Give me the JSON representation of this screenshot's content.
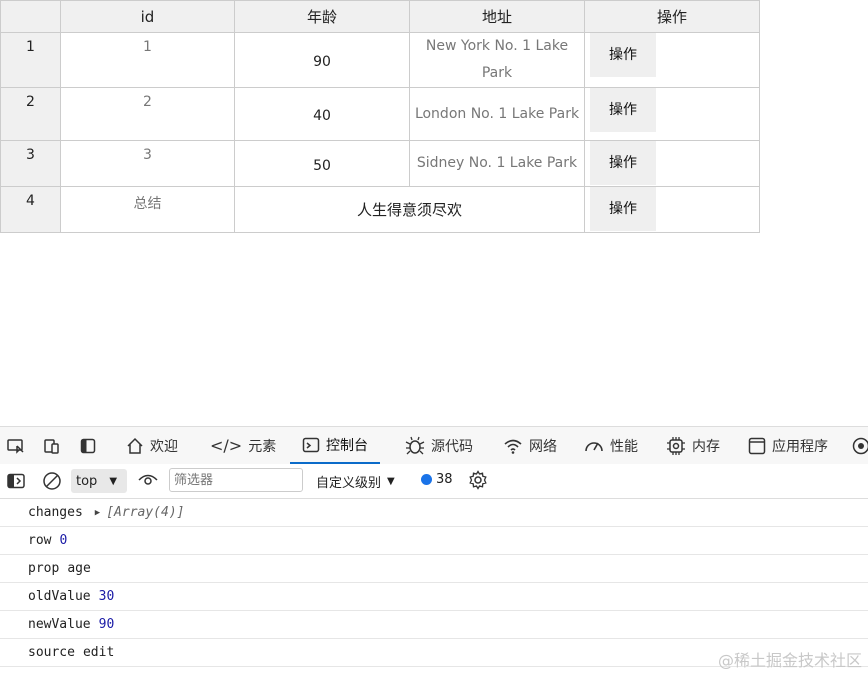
{
  "table": {
    "headers": [
      "",
      "id",
      "年龄",
      "地址",
      "操作"
    ],
    "rows": [
      {
        "rownum": "1",
        "id": "1",
        "age": "90",
        "address": "New York No. 1 Lake Park",
        "op": "操作"
      },
      {
        "rownum": "2",
        "id": "2",
        "age": "40",
        "address": "London No. 1 Lake Park",
        "op": "操作"
      },
      {
        "rownum": "3",
        "id": "3",
        "age": "50",
        "address": "Sidney No. 1 Lake Park",
        "op": "操作"
      }
    ],
    "summary": {
      "rownum": "4",
      "id": "总结",
      "merged": "人生得意须尽欢",
      "op": "操作"
    }
  },
  "devtools": {
    "tabs": {
      "welcome": "欢迎",
      "elements": "元素",
      "console": "控制台",
      "sources": "源代码",
      "network": "网络",
      "performance": "性能",
      "memory": "内存",
      "application": "应用程序"
    },
    "toolbar": {
      "context": "top",
      "filter_placeholder": "筛选器",
      "level": "自定义级别",
      "message_count": "38"
    },
    "console_lines": [
      {
        "key": "changes",
        "value": "[Array(4)]"
      },
      {
        "key": "row",
        "value": "0"
      },
      {
        "key": "prop",
        "value": "age"
      },
      {
        "key": "oldValue",
        "value": "30"
      },
      {
        "key": "newValue",
        "value": "90"
      },
      {
        "key": "source",
        "value": "edit"
      }
    ]
  },
  "watermark": "@稀土掘金技术社区"
}
